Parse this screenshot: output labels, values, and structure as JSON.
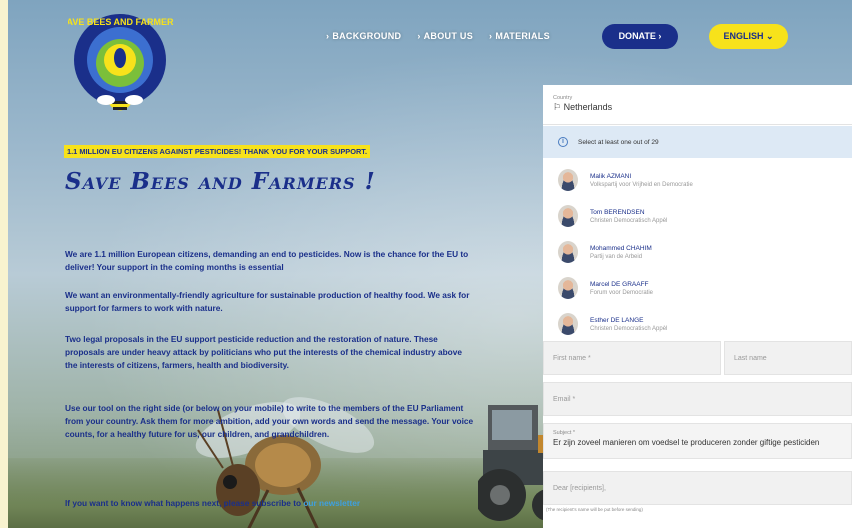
{
  "nav": {
    "links": [
      "BACKGROUND",
      "ABOUT US",
      "MATERIALS"
    ],
    "donate": "DONATE",
    "language": "ENGLISH"
  },
  "logo": {
    "text": "SAVE BEES AND FARMERS"
  },
  "banner": "1.1 MILLION EU CITIZENS AGAINST PESTICIDES! THANK YOU FOR YOUR SUPPORT.",
  "title": "Save Bees and Farmers !",
  "paragraphs": {
    "p1": "We are 1.1 million European citizens, demanding an end to pesticides. Now is the chance for the EU to deliver! Your support in the coming months is essential",
    "p2": "We want an environmentally-friendly agriculture for sustainable production of healthy food. We ask for support for farmers to work with nature.",
    "p3": "Two legal proposals in the EU support pesticide reduction and the restoration of nature. These proposals are under heavy attack by politicians who put the interests of the chemical industry above the interests of citizens, farmers, health and biodiversity.",
    "p4": "Use our tool on the right side (or below on your mobile) to write to the members of the EU Parliament from your country. Ask them for more ambition, add your own words and send the message. Your voice counts, for a healthy future for us, our children, and grandchildren.",
    "p5_text": "If you want to know what happens next, please subscribe to ",
    "p5_link": "our newsletter"
  },
  "form": {
    "country_label": "Country",
    "country_value": "Netherlands",
    "info": "Select at least one out of 29",
    "meps": [
      {
        "name": "Malik AZMANI",
        "party": "Volkspartij voor Vrijheid en Democratie"
      },
      {
        "name": "Tom BERENDSEN",
        "party": "Christen Democratisch Appèl"
      },
      {
        "name": "Mohammed CHAHIM",
        "party": "Partij van de Arbeid"
      },
      {
        "name": "Marcel DE GRAAFF",
        "party": "Forum voor Democratie"
      },
      {
        "name": "Esther DE LANGE",
        "party": "Christen Democratisch Appèl"
      }
    ],
    "first_name_placeholder": "First name *",
    "last_name_placeholder": "Last name",
    "email_placeholder": "Email *",
    "subject_label": "Subject *",
    "subject_value": "Er zijn zoveel manieren om voedsel te produceren zonder giftige pesticiden",
    "message_placeholder": "Dear [recipients],",
    "note": "(The recipient's name will be put before sending)"
  }
}
